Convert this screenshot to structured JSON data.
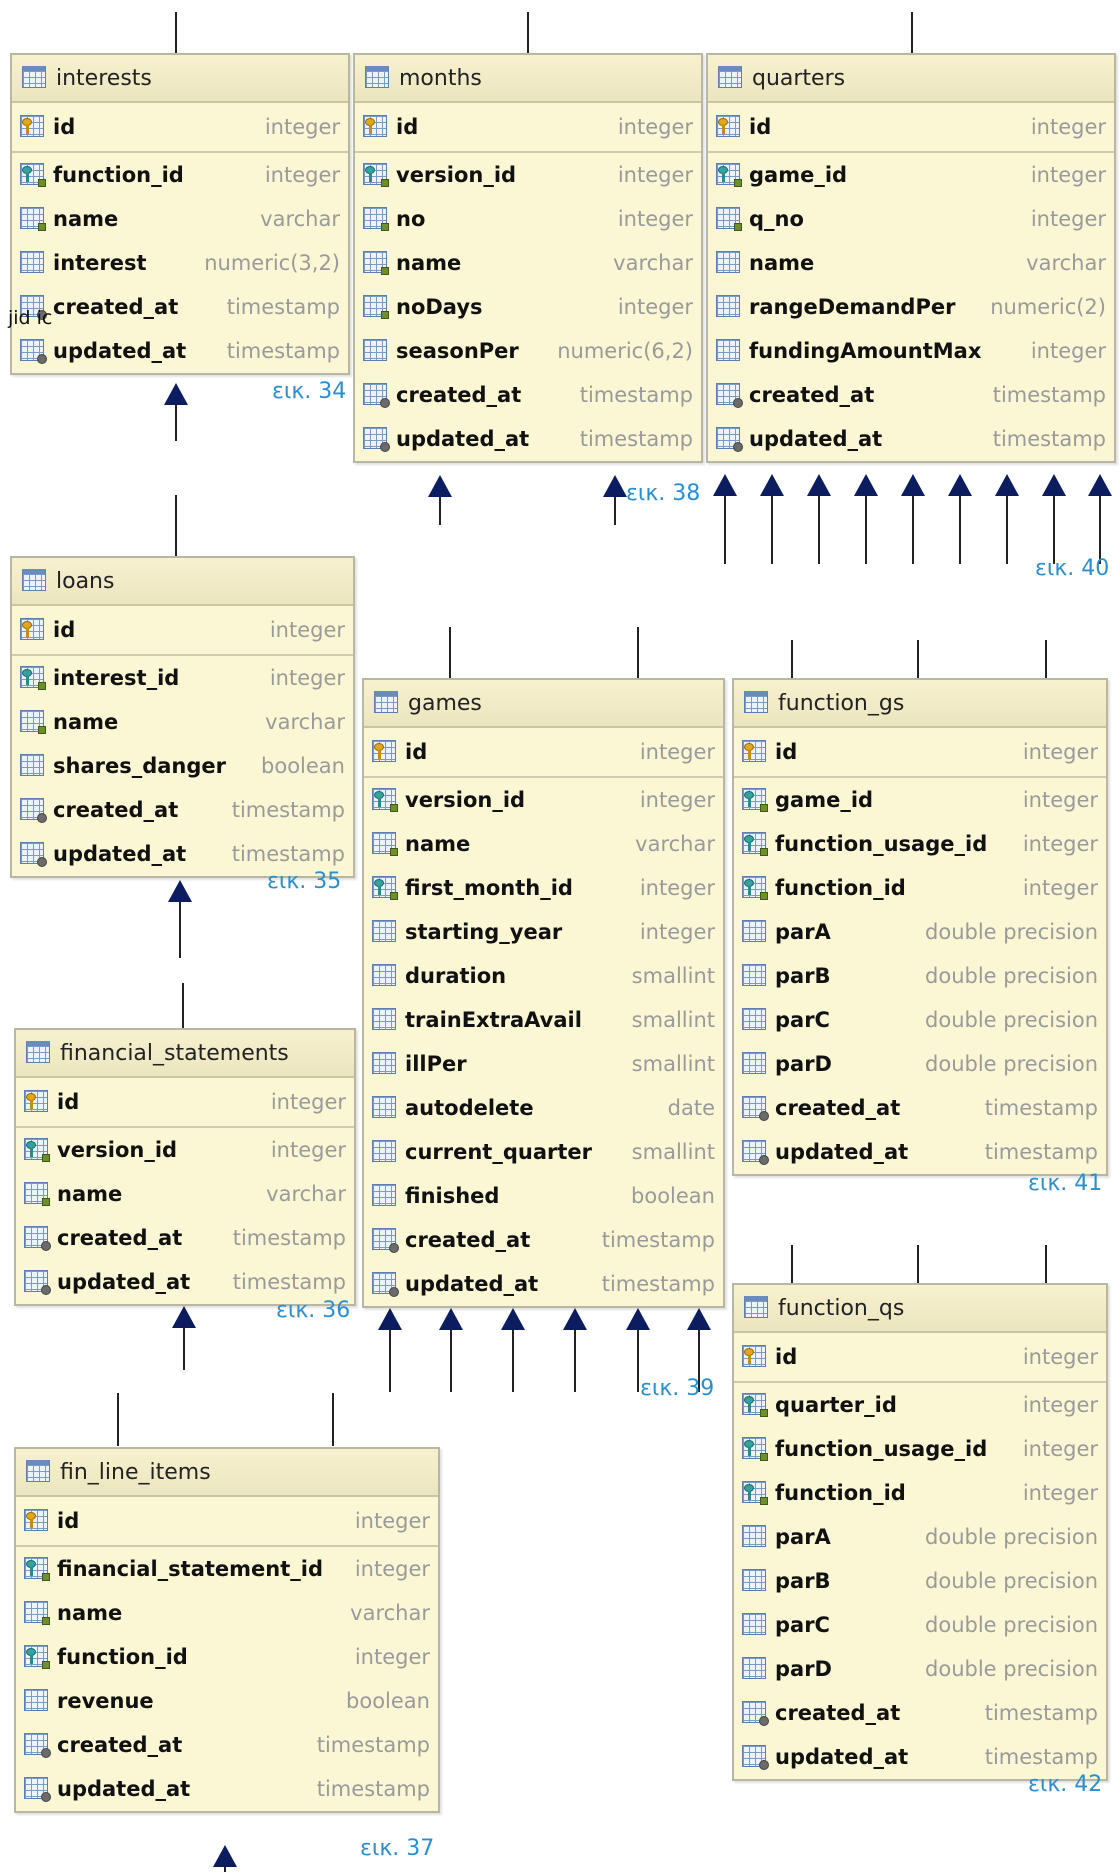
{
  "tables": [
    {
      "key": "interests",
      "name": "interests",
      "columns": [
        {
          "name": "id",
          "type": "integer",
          "kind": "pk"
        },
        {
          "name": "function_id",
          "type": "integer",
          "kind": "fk"
        },
        {
          "name": "name",
          "type": "varchar",
          "kind": "nn"
        },
        {
          "name": "interest",
          "type": "numeric(3,2)",
          "kind": "plain"
        },
        {
          "name": "created_at",
          "type": "timestamp",
          "kind": "ts"
        },
        {
          "name": "updated_at",
          "type": "timestamp",
          "kind": "ts"
        }
      ]
    },
    {
      "key": "months",
      "name": "months",
      "columns": [
        {
          "name": "id",
          "type": "integer",
          "kind": "pk"
        },
        {
          "name": "version_id",
          "type": "integer",
          "kind": "fk"
        },
        {
          "name": "no",
          "type": "integer",
          "kind": "nn"
        },
        {
          "name": "name",
          "type": "varchar",
          "kind": "nn"
        },
        {
          "name": "noDays",
          "type": "integer",
          "kind": "nn"
        },
        {
          "name": "seasonPer",
          "type": "numeric(6,2)",
          "kind": "plain"
        },
        {
          "name": "created_at",
          "type": "timestamp",
          "kind": "ts"
        },
        {
          "name": "updated_at",
          "type": "timestamp",
          "kind": "ts"
        }
      ]
    },
    {
      "key": "quarters",
      "name": "quarters",
      "columns": [
        {
          "name": "id",
          "type": "integer",
          "kind": "pk"
        },
        {
          "name": "game_id",
          "type": "integer",
          "kind": "fk"
        },
        {
          "name": "q_no",
          "type": "integer",
          "kind": "nn"
        },
        {
          "name": "name",
          "type": "varchar",
          "kind": "plain"
        },
        {
          "name": "rangeDemandPer",
          "type": "numeric(2)",
          "kind": "plain"
        },
        {
          "name": "fundingAmountMax",
          "type": "integer",
          "kind": "plain"
        },
        {
          "name": "created_at",
          "type": "timestamp",
          "kind": "ts"
        },
        {
          "name": "updated_at",
          "type": "timestamp",
          "kind": "ts"
        }
      ]
    },
    {
      "key": "loans",
      "name": "loans",
      "columns": [
        {
          "name": "id",
          "type": "integer",
          "kind": "pk"
        },
        {
          "name": "interest_id",
          "type": "integer",
          "kind": "fk"
        },
        {
          "name": "name",
          "type": "varchar",
          "kind": "nn"
        },
        {
          "name": "shares_danger",
          "type": "boolean",
          "kind": "plain"
        },
        {
          "name": "created_at",
          "type": "timestamp",
          "kind": "ts"
        },
        {
          "name": "updated_at",
          "type": "timestamp",
          "kind": "ts"
        }
      ]
    },
    {
      "key": "games",
      "name": "games",
      "columns": [
        {
          "name": "id",
          "type": "integer",
          "kind": "pk"
        },
        {
          "name": "version_id",
          "type": "integer",
          "kind": "fk"
        },
        {
          "name": "name",
          "type": "varchar",
          "kind": "nn"
        },
        {
          "name": "first_month_id",
          "type": "integer",
          "kind": "fk"
        },
        {
          "name": "starting_year",
          "type": "integer",
          "kind": "plain"
        },
        {
          "name": "duration",
          "type": "smallint",
          "kind": "plain"
        },
        {
          "name": "trainExtraAvail",
          "type": "smallint",
          "kind": "plain"
        },
        {
          "name": "illPer",
          "type": "smallint",
          "kind": "plain"
        },
        {
          "name": "autodelete",
          "type": "date",
          "kind": "plain"
        },
        {
          "name": "current_quarter",
          "type": "smallint",
          "kind": "plain"
        },
        {
          "name": "finished",
          "type": "boolean",
          "kind": "plain"
        },
        {
          "name": "created_at",
          "type": "timestamp",
          "kind": "ts"
        },
        {
          "name": "updated_at",
          "type": "timestamp",
          "kind": "ts"
        }
      ]
    },
    {
      "key": "function_gs",
      "name": "function_gs",
      "columns": [
        {
          "name": "id",
          "type": "integer",
          "kind": "pk"
        },
        {
          "name": "game_id",
          "type": "integer",
          "kind": "fk"
        },
        {
          "name": "function_usage_id",
          "type": "integer",
          "kind": "fk"
        },
        {
          "name": "function_id",
          "type": "integer",
          "kind": "fk"
        },
        {
          "name": "parA",
          "type": "double precision",
          "kind": "plain"
        },
        {
          "name": "parB",
          "type": "double precision",
          "kind": "plain"
        },
        {
          "name": "parC",
          "type": "double precision",
          "kind": "plain"
        },
        {
          "name": "parD",
          "type": "double precision",
          "kind": "plain"
        },
        {
          "name": "created_at",
          "type": "timestamp",
          "kind": "ts"
        },
        {
          "name": "updated_at",
          "type": "timestamp",
          "kind": "ts"
        }
      ]
    },
    {
      "key": "financial_statements",
      "name": "financial_statements",
      "columns": [
        {
          "name": "id",
          "type": "integer",
          "kind": "pk"
        },
        {
          "name": "version_id",
          "type": "integer",
          "kind": "fk"
        },
        {
          "name": "name",
          "type": "varchar",
          "kind": "nn"
        },
        {
          "name": "created_at",
          "type": "timestamp",
          "kind": "ts"
        },
        {
          "name": "updated_at",
          "type": "timestamp",
          "kind": "ts"
        }
      ]
    },
    {
      "key": "function_qs",
      "name": "function_qs",
      "columns": [
        {
          "name": "id",
          "type": "integer",
          "kind": "pk"
        },
        {
          "name": "quarter_id",
          "type": "integer",
          "kind": "fk"
        },
        {
          "name": "function_usage_id",
          "type": "integer",
          "kind": "fk"
        },
        {
          "name": "function_id",
          "type": "integer",
          "kind": "fk"
        },
        {
          "name": "parA",
          "type": "double precision",
          "kind": "plain"
        },
        {
          "name": "parB",
          "type": "double precision",
          "kind": "plain"
        },
        {
          "name": "parC",
          "type": "double precision",
          "kind": "plain"
        },
        {
          "name": "parD",
          "type": "double precision",
          "kind": "plain"
        },
        {
          "name": "created_at",
          "type": "timestamp",
          "kind": "ts"
        },
        {
          "name": "updated_at",
          "type": "timestamp",
          "kind": "ts"
        }
      ]
    },
    {
      "key": "fin_line_items",
      "name": "fin_line_items",
      "columns": [
        {
          "name": "id",
          "type": "integer",
          "kind": "pk"
        },
        {
          "name": "financial_statement_id",
          "type": "integer",
          "kind": "fk"
        },
        {
          "name": "name",
          "type": "varchar",
          "kind": "nn"
        },
        {
          "name": "function_id",
          "type": "integer",
          "kind": "fk"
        },
        {
          "name": "revenue",
          "type": "boolean",
          "kind": "plain"
        },
        {
          "name": "created_at",
          "type": "timestamp",
          "kind": "ts"
        },
        {
          "name": "updated_at",
          "type": "timestamp",
          "kind": "ts"
        }
      ]
    }
  ],
  "figure_labels": {
    "interests": "εικ. 34",
    "loans": "εικ. 35",
    "financial_statements": "εικ. 36",
    "fin_line_items": "εικ. 37",
    "months": "εικ. 38",
    "games": "εικ. 39",
    "quarters": "εικ. 40",
    "function_gs": "εικ. 41",
    "function_qs": "εικ. 42"
  },
  "stray_text": "jid ic",
  "colors": {
    "table_fill": "#fbf6d4",
    "table_border": "#b8b8a2",
    "column_type": "#9a9a9a",
    "figure_label": "#2a8fd1",
    "arrow": "#0b1d5e",
    "line": "#222222"
  }
}
